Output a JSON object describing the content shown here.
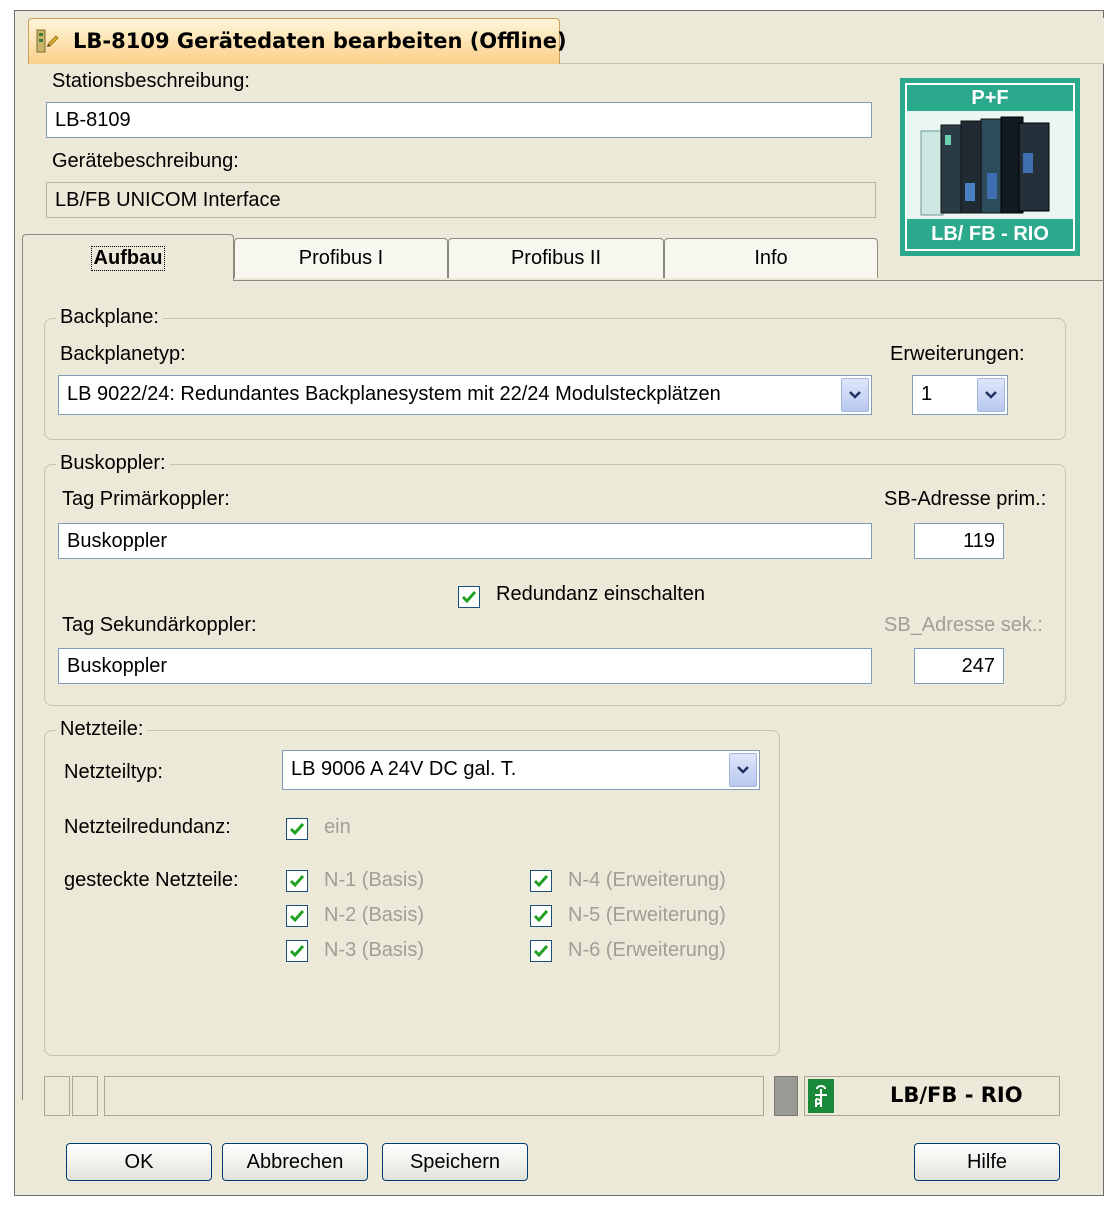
{
  "window": {
    "title": "LB-8109 Gerätedaten bearbeiten (Offline)"
  },
  "station": {
    "label": "Stationsbeschreibung:",
    "value": "LB-8109"
  },
  "device": {
    "label": "Gerätebeschreibung:",
    "value": "LB/FB UNICOM Interface"
  },
  "logo": {
    "top_text": "P+F",
    "bottom_text": "LB/ FB - RIO",
    "border_color": "#2aa98d"
  },
  "tabs": [
    {
      "label": "Aufbau",
      "active": true
    },
    {
      "label": "Profibus I",
      "active": false
    },
    {
      "label": "Profibus II",
      "active": false
    },
    {
      "label": "Info",
      "active": false
    }
  ],
  "backplane": {
    "group_title": "Backplane:",
    "type_label": "Backplanetyp:",
    "type_value": "LB 9022/24: Redundantes Backplanesystem mit 22/24 Modulsteckplätzen",
    "ext_label": "Erweiterungen:",
    "ext_value": "1"
  },
  "buskoppler": {
    "group_title": "Buskoppler:",
    "primary_label": "Tag Primärkoppler:",
    "primary_value": "Buskoppler",
    "primary_addr_label": "SB-Adresse prim.:",
    "primary_addr_value": "119",
    "redundancy_label": "Redundanz einschalten",
    "redundancy_checked": true,
    "secondary_label": "Tag Sekundärkoppler:",
    "secondary_value": "Buskoppler",
    "secondary_addr_label": "SB_Adresse sek.:",
    "secondary_addr_value": "247"
  },
  "netzteile": {
    "group_title": "Netzteile:",
    "type_label": "Netzteiltyp:",
    "type_value": "LB 9006 A 24V DC gal. T.",
    "redundancy_label": "Netzteilredundanz:",
    "redundancy_option": "ein",
    "plugged_label": "gesteckte Netzteile:",
    "units": [
      {
        "label": "N-1 (Basis)",
        "checked": true
      },
      {
        "label": "N-2 (Basis)",
        "checked": true
      },
      {
        "label": "N-3 (Basis)",
        "checked": true
      },
      {
        "label": "N-4 (Erweiterung)",
        "checked": true
      },
      {
        "label": "N-5 (Erweiterung)",
        "checked": true
      },
      {
        "label": "N-6 (Erweiterung)",
        "checked": true
      }
    ]
  },
  "statusbar": {
    "product": "LB/FB - RIO",
    "brand_color": "#1a8a3a"
  },
  "buttons": {
    "ok": "OK",
    "cancel": "Abbrechen",
    "save": "Speichern",
    "help": "Hilfe"
  }
}
